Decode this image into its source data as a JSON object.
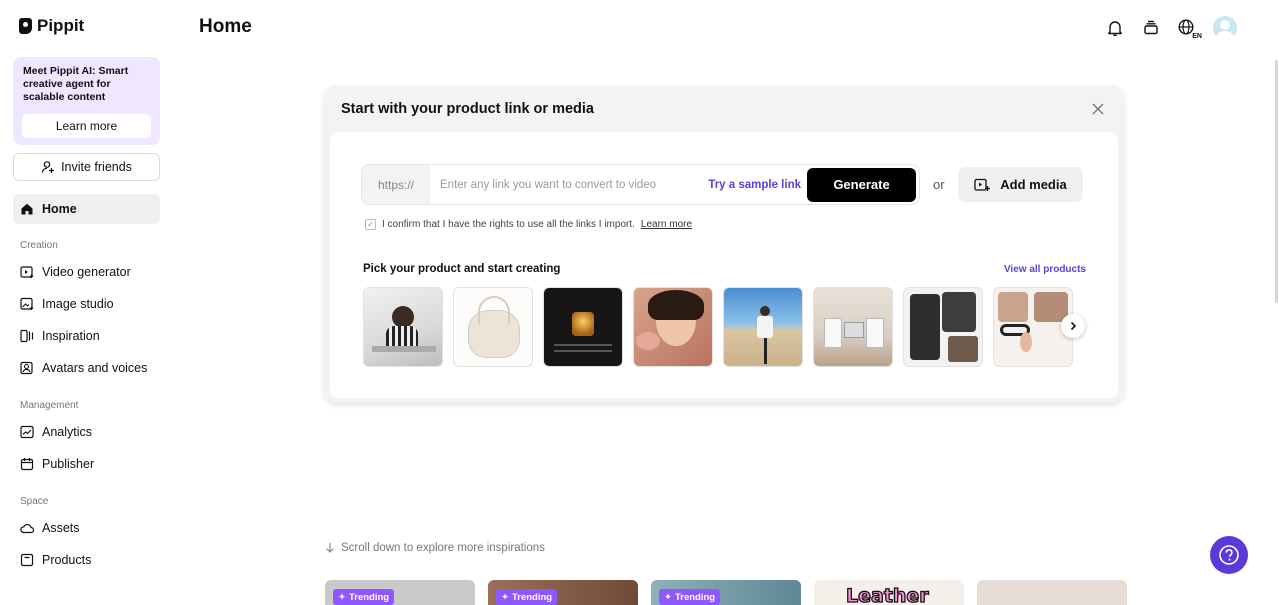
{
  "brand": {
    "name": "Pippit"
  },
  "promo": {
    "text": "Meet Pippit AI: Smart creative agent for scalable content",
    "button": "Learn more"
  },
  "invite": {
    "label": "Invite friends"
  },
  "nav": {
    "home": "Home",
    "creation_label": "Creation",
    "video_generator": "Video generator",
    "image_studio": "Image studio",
    "inspiration": "Inspiration",
    "avatars": "Avatars and voices",
    "management_label": "Management",
    "analytics": "Analytics",
    "publisher": "Publisher",
    "space_label": "Space",
    "assets": "Assets",
    "products": "Products"
  },
  "header": {
    "title": "Home",
    "lang": "EN"
  },
  "card": {
    "title": "Start with your product link or media",
    "https": "https://",
    "placeholder": "Enter any link you want to convert to video",
    "sample_link": "Try a sample link",
    "generate": "Generate",
    "or": "or",
    "add_media": "Add media",
    "confirm_text": "I confirm that I have the rights to use all the links I import.",
    "confirm_link": "Learn more",
    "pick_title": "Pick your product and start creating",
    "view_all": "View all products"
  },
  "scroll_hint": "Scroll down to explore more inspirations",
  "inspirations": {
    "badge": "Trending",
    "leather_text": "Leather"
  },
  "colors": {
    "accent": "#5b3fd9",
    "promo_bg": "#efe6ff",
    "help": "#5a3ad8"
  }
}
